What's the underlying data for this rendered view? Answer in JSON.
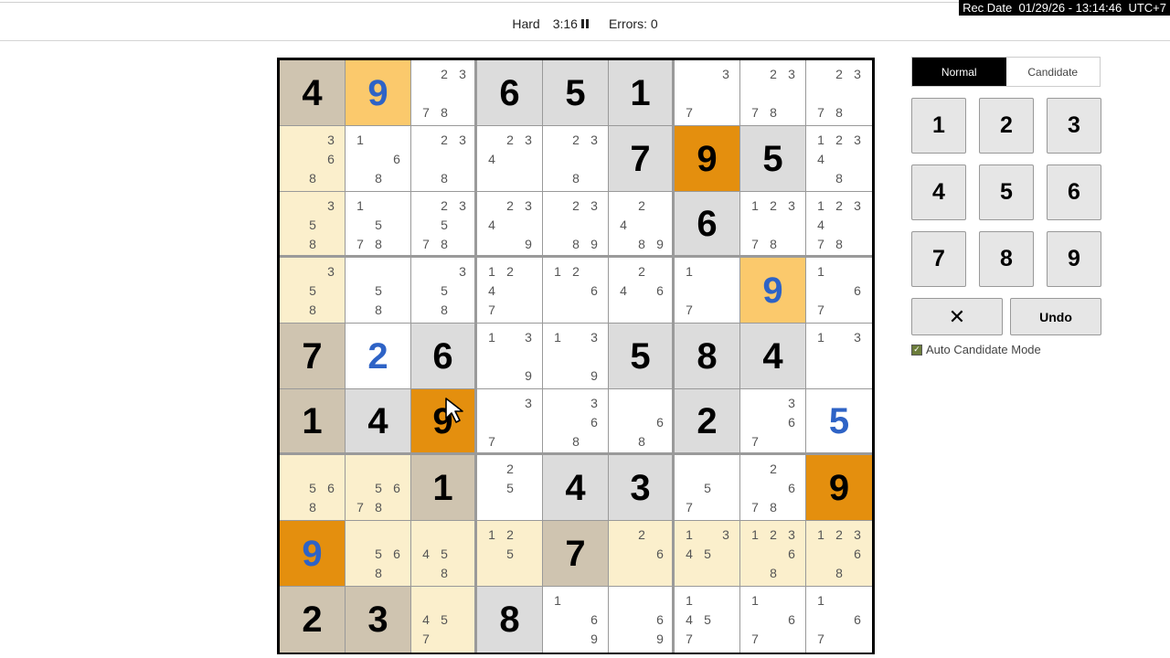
{
  "recording": {
    "stamp": "Rec Date  01/29/26 - 13:14:46  UTC+7"
  },
  "header": {
    "difficulty": "Hard",
    "timer": "3:16",
    "errors": "Errors: 0"
  },
  "colors": {
    "given_bg": "#dcdcdc",
    "highlight": "#fbc96c",
    "selected": "#e48f0e",
    "peer": "#fbefcc",
    "user_digit": "#2e63c6"
  },
  "board": {
    "selected_cell": "r6c3",
    "rows": [
      [
        {
          "v": "4",
          "t": "given",
          "s": "given-peer"
        },
        {
          "v": "9",
          "t": "user",
          "s": "hl"
        },
        {
          "c": [
            "",
            "2",
            "3",
            "",
            "",
            "",
            "7",
            "8",
            ""
          ],
          "s": ""
        },
        {
          "v": "6",
          "t": "given",
          "s": "given"
        },
        {
          "v": "5",
          "t": "given",
          "s": "given"
        },
        {
          "v": "1",
          "t": "given",
          "s": "given"
        },
        {
          "c": [
            "",
            "",
            "3",
            "",
            "",
            "",
            "7",
            "",
            ""
          ],
          "s": ""
        },
        {
          "c": [
            "",
            "2",
            "3",
            "",
            "",
            "",
            "7",
            "8",
            ""
          ],
          "s": ""
        },
        {
          "c": [
            "",
            "2",
            "3",
            "",
            "",
            "",
            "7",
            "8",
            ""
          ],
          "s": ""
        }
      ],
      [
        {
          "c": [
            "",
            "",
            "3",
            "",
            "",
            "6",
            "",
            "8",
            ""
          ],
          "s": "peer"
        },
        {
          "c": [
            "1",
            "",
            "",
            "",
            "",
            "6",
            "",
            "8",
            ""
          ],
          "s": ""
        },
        {
          "c": [
            "",
            "2",
            "3",
            "",
            "",
            "",
            "",
            "8",
            ""
          ],
          "s": ""
        },
        {
          "c": [
            "",
            "2",
            "3",
            "4",
            "",
            "",
            "",
            "",
            ""
          ],
          "s": ""
        },
        {
          "c": [
            "",
            "2",
            "3",
            "",
            "",
            "",
            "",
            "8",
            ""
          ],
          "s": ""
        },
        {
          "v": "7",
          "t": "given",
          "s": "given"
        },
        {
          "v": "9",
          "t": "given",
          "s": "sel"
        },
        {
          "v": "5",
          "t": "given",
          "s": "given"
        },
        {
          "c": [
            "1",
            "2",
            "3",
            "4",
            "",
            "",
            "",
            "8",
            ""
          ],
          "s": ""
        }
      ],
      [
        {
          "c": [
            "",
            "",
            "3",
            "",
            "5",
            "",
            "",
            "8",
            ""
          ],
          "s": "peer"
        },
        {
          "c": [
            "1",
            "",
            "",
            "",
            "5",
            "",
            "7",
            "8",
            ""
          ],
          "s": ""
        },
        {
          "c": [
            "",
            "2",
            "3",
            "",
            "5",
            "",
            "7",
            "8",
            ""
          ],
          "s": ""
        },
        {
          "c": [
            "",
            "2",
            "3",
            "4",
            "",
            "",
            "",
            "",
            "9"
          ],
          "s": ""
        },
        {
          "c": [
            "",
            "2",
            "3",
            "",
            "",
            "",
            "",
            "8",
            "9"
          ],
          "s": ""
        },
        {
          "c": [
            "",
            "2",
            "",
            "4",
            "",
            "",
            "",
            "8",
            "9"
          ],
          "s": ""
        },
        {
          "v": "6",
          "t": "given",
          "s": "given"
        },
        {
          "c": [
            "1",
            "2",
            "3",
            "",
            "",
            "",
            "7",
            "8",
            ""
          ],
          "s": ""
        },
        {
          "c": [
            "1",
            "2",
            "3",
            "4",
            "",
            "",
            "7",
            "8",
            ""
          ],
          "s": ""
        }
      ],
      [
        {
          "c": [
            "",
            "",
            "3",
            "",
            "5",
            "",
            "",
            "8",
            ""
          ],
          "s": "peer"
        },
        {
          "c": [
            "",
            "",
            "",
            "",
            "5",
            "",
            "",
            "8",
            ""
          ],
          "s": ""
        },
        {
          "c": [
            "",
            "",
            "3",
            "",
            "5",
            "",
            "",
            "8",
            ""
          ],
          "s": ""
        },
        {
          "c": [
            "1",
            "2",
            "",
            "4",
            "",
            "",
            "7",
            "",
            ""
          ],
          "s": ""
        },
        {
          "c": [
            "1",
            "2",
            "",
            "",
            "",
            "6",
            "",
            "",
            ""
          ],
          "s": ""
        },
        {
          "c": [
            "",
            "2",
            "",
            "4",
            "",
            "6",
            "",
            "",
            ""
          ],
          "s": ""
        },
        {
          "c": [
            "1",
            "",
            "",
            "",
            "",
            "",
            "7",
            "",
            ""
          ],
          "s": ""
        },
        {
          "v": "9",
          "t": "user",
          "s": "hl"
        },
        {
          "c": [
            "1",
            "",
            "",
            "",
            "",
            "6",
            "7",
            "",
            ""
          ],
          "s": ""
        }
      ],
      [
        {
          "v": "7",
          "t": "given",
          "s": "given-peer"
        },
        {
          "v": "2",
          "t": "user",
          "s": ""
        },
        {
          "v": "6",
          "t": "given",
          "s": "given"
        },
        {
          "c": [
            "1",
            "",
            "3",
            "",
            "",
            "",
            "",
            "",
            "9"
          ],
          "s": ""
        },
        {
          "c": [
            "1",
            "",
            "3",
            "",
            "",
            "",
            "",
            "",
            "9"
          ],
          "s": ""
        },
        {
          "v": "5",
          "t": "given",
          "s": "given"
        },
        {
          "v": "8",
          "t": "given",
          "s": "given"
        },
        {
          "v": "4",
          "t": "given",
          "s": "given"
        },
        {
          "c": [
            "1",
            "",
            "3",
            "",
            "",
            "",
            "",
            "",
            ""
          ],
          "s": ""
        }
      ],
      [
        {
          "v": "1",
          "t": "given",
          "s": "given-peer"
        },
        {
          "v": "4",
          "t": "given",
          "s": "given"
        },
        {
          "v": "9",
          "t": "given",
          "s": "sel"
        },
        {
          "c": [
            "",
            "",
            "3",
            "",
            "",
            "",
            "7",
            "",
            ""
          ],
          "s": ""
        },
        {
          "c": [
            "",
            "",
            "3",
            "",
            "",
            "6",
            "",
            "8",
            ""
          ],
          "s": ""
        },
        {
          "c": [
            "",
            "",
            "",
            "",
            "",
            "6",
            "",
            "8",
            ""
          ],
          "s": ""
        },
        {
          "v": "2",
          "t": "given",
          "s": "given"
        },
        {
          "c": [
            "",
            "",
            "3",
            "",
            "",
            "6",
            "7",
            "",
            ""
          ],
          "s": ""
        },
        {
          "v": "5",
          "t": "user",
          "s": ""
        }
      ],
      [
        {
          "c": [
            "",
            "",
            "",
            "",
            "5",
            "6",
            "",
            "8",
            ""
          ],
          "s": "peer"
        },
        {
          "c": [
            "",
            "",
            "",
            "",
            "5",
            "6",
            "7",
            "8",
            ""
          ],
          "s": "peer"
        },
        {
          "v": "1",
          "t": "given",
          "s": "given-peer"
        },
        {
          "c": [
            "",
            "2",
            "",
            "",
            "5",
            "",
            "",
            "",
            ""
          ],
          "s": ""
        },
        {
          "v": "4",
          "t": "given",
          "s": "given"
        },
        {
          "v": "3",
          "t": "given",
          "s": "given"
        },
        {
          "c": [
            "",
            "",
            "",
            "",
            "5",
            "",
            "7",
            "",
            ""
          ],
          "s": ""
        },
        {
          "c": [
            "",
            "2",
            "",
            "",
            "",
            "6",
            "7",
            "8",
            ""
          ],
          "s": ""
        },
        {
          "v": "9",
          "t": "given",
          "s": "sel"
        }
      ],
      [
        {
          "v": "9",
          "t": "user",
          "s": "sel"
        },
        {
          "c": [
            "",
            "",
            "",
            "",
            "5",
            "6",
            "",
            "8",
            ""
          ],
          "s": "peer"
        },
        {
          "c": [
            "",
            "",
            "",
            "4",
            "5",
            "",
            "",
            "8",
            ""
          ],
          "s": "peer"
        },
        {
          "c": [
            "1",
            "2",
            "",
            "",
            "5",
            "",
            "",
            "",
            ""
          ],
          "s": "peer"
        },
        {
          "v": "7",
          "t": "given",
          "s": "given-peer"
        },
        {
          "c": [
            "",
            "2",
            "",
            "",
            "",
            "6",
            "",
            "",
            ""
          ],
          "s": "peer"
        },
        {
          "c": [
            "1",
            "",
            "3",
            "4",
            "5",
            "",
            "",
            "",
            ""
          ],
          "s": "peer"
        },
        {
          "c": [
            "1",
            "2",
            "3",
            "",
            "",
            "6",
            "",
            "8",
            ""
          ],
          "s": "peer"
        },
        {
          "c": [
            "1",
            "2",
            "3",
            "",
            "",
            "6",
            "",
            "8",
            ""
          ],
          "s": "peer"
        }
      ],
      [
        {
          "v": "2",
          "t": "given",
          "s": "given-peer"
        },
        {
          "v": "3",
          "t": "given",
          "s": "given-peer"
        },
        {
          "c": [
            "",
            "",
            "",
            "4",
            "5",
            "",
            "7",
            "",
            ""
          ],
          "s": "peer"
        },
        {
          "v": "8",
          "t": "given",
          "s": "given"
        },
        {
          "c": [
            "1",
            "",
            "",
            "",
            "",
            "6",
            "",
            "",
            "9"
          ],
          "s": ""
        },
        {
          "c": [
            "",
            "",
            "",
            "",
            "",
            "6",
            "",
            "",
            "9"
          ],
          "s": ""
        },
        {
          "c": [
            "1",
            "",
            "",
            "4",
            "5",
            "",
            "7",
            "",
            ""
          ],
          "s": ""
        },
        {
          "c": [
            "1",
            "",
            "",
            "",
            "",
            "6",
            "7",
            "",
            ""
          ],
          "s": ""
        },
        {
          "c": [
            "1",
            "",
            "",
            "",
            "",
            "6",
            "7",
            "",
            ""
          ],
          "s": ""
        }
      ]
    ]
  },
  "controls": {
    "tabs": [
      "Normal",
      "Candidate"
    ],
    "active_tab": "Normal",
    "numbers": [
      "1",
      "2",
      "3",
      "4",
      "5",
      "6",
      "7",
      "8",
      "9"
    ],
    "clear_label": "✕",
    "undo_label": "Undo",
    "auto_candidate_label": "Auto Candidate Mode",
    "auto_candidate_checked": true
  }
}
